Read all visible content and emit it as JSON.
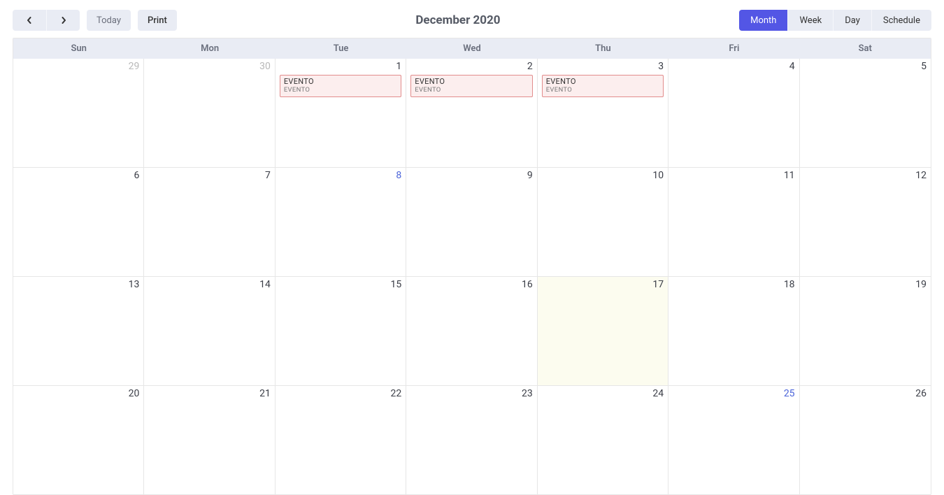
{
  "header": {
    "title": "December 2020",
    "today_label": "Today",
    "print_label": "Print"
  },
  "views": {
    "items": [
      {
        "label": "Month",
        "active": true
      },
      {
        "label": "Week",
        "active": false
      },
      {
        "label": "Day",
        "active": false
      },
      {
        "label": "Schedule",
        "active": false
      }
    ]
  },
  "weekdays": [
    "Sun",
    "Mon",
    "Tue",
    "Wed",
    "Thu",
    "Fri",
    "Sat"
  ],
  "weeks": [
    [
      {
        "num": "29",
        "other": true
      },
      {
        "num": "30",
        "other": true
      },
      {
        "num": "1",
        "events": [
          {
            "title": "EVENTO",
            "sub": "EVENTO"
          }
        ]
      },
      {
        "num": "2",
        "events": [
          {
            "title": "EVENTO",
            "sub": "EVENTO"
          }
        ]
      },
      {
        "num": "3",
        "events": [
          {
            "title": "EVENTO",
            "sub": "EVENTO"
          }
        ]
      },
      {
        "num": "4"
      },
      {
        "num": "5"
      }
    ],
    [
      {
        "num": "6"
      },
      {
        "num": "7"
      },
      {
        "num": "8",
        "special": true
      },
      {
        "num": "9"
      },
      {
        "num": "10"
      },
      {
        "num": "11"
      },
      {
        "num": "12"
      }
    ],
    [
      {
        "num": "13"
      },
      {
        "num": "14"
      },
      {
        "num": "15"
      },
      {
        "num": "16"
      },
      {
        "num": "17",
        "today": true
      },
      {
        "num": "18"
      },
      {
        "num": "19"
      }
    ],
    [
      {
        "num": "20"
      },
      {
        "num": "21"
      },
      {
        "num": "22"
      },
      {
        "num": "23"
      },
      {
        "num": "24"
      },
      {
        "num": "25",
        "special": true
      },
      {
        "num": "26"
      }
    ]
  ]
}
